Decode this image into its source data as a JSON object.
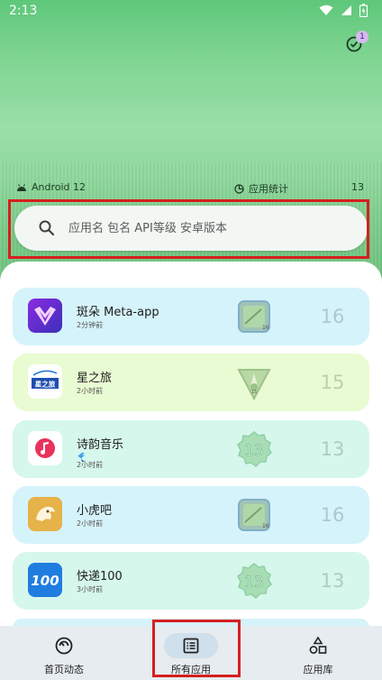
{
  "status_bar": {
    "time": "2:13",
    "wifi_icon": "wifi-icon",
    "signal_icon": "cell-signal-icon",
    "battery_icon": "battery-icon"
  },
  "header": {
    "notification_icon": "notification-icon",
    "notification_count": "1",
    "android_version": "Android 12",
    "stats_label": "应用统计",
    "stats_count": "13"
  },
  "search": {
    "placeholder": "应用名 包名 API等级 安卓版本",
    "value": ""
  },
  "apps": [
    {
      "name": "斑朵 Meta-app",
      "time": "2分钟前",
      "api": "16",
      "icon": "bandou-app-icon",
      "badge": "android-16-badge",
      "card_color": "#d5f3fa"
    },
    {
      "name": "星之旅",
      "time": "2小时前",
      "api": "15",
      "icon": "xingzhilv-app-icon",
      "badge": "android-15-badge",
      "card_color": "#e9fbd2"
    },
    {
      "name": "诗韵音乐",
      "time": "2小时前",
      "api": "13",
      "icon": "shiyun-music-app-icon",
      "badge": "android-13-badge",
      "card_color": "#d6f7ec",
      "flutter": true
    },
    {
      "name": "小虎吧",
      "time": "2小时前",
      "api": "16",
      "icon": "xiaohuba-app-icon",
      "badge": "android-16-badge",
      "card_color": "#d5f3fa"
    },
    {
      "name": "快递100",
      "time": "3小时前",
      "api": "13",
      "icon": "kuaidi100-app-icon",
      "badge": "android-13-badge",
      "card_color": "#d6f7ec"
    }
  ],
  "bottom_nav": {
    "items": [
      {
        "label": "首页动态",
        "icon": "home-feed-icon"
      },
      {
        "label": "所有应用",
        "icon": "all-apps-list-icon",
        "active": true
      },
      {
        "label": "应用库",
        "icon": "app-library-icon"
      }
    ]
  },
  "colors": {
    "highlight": "#d61f1f",
    "nav_background": "#e6ecef",
    "nav_active_pill": "#cfe0ec"
  }
}
